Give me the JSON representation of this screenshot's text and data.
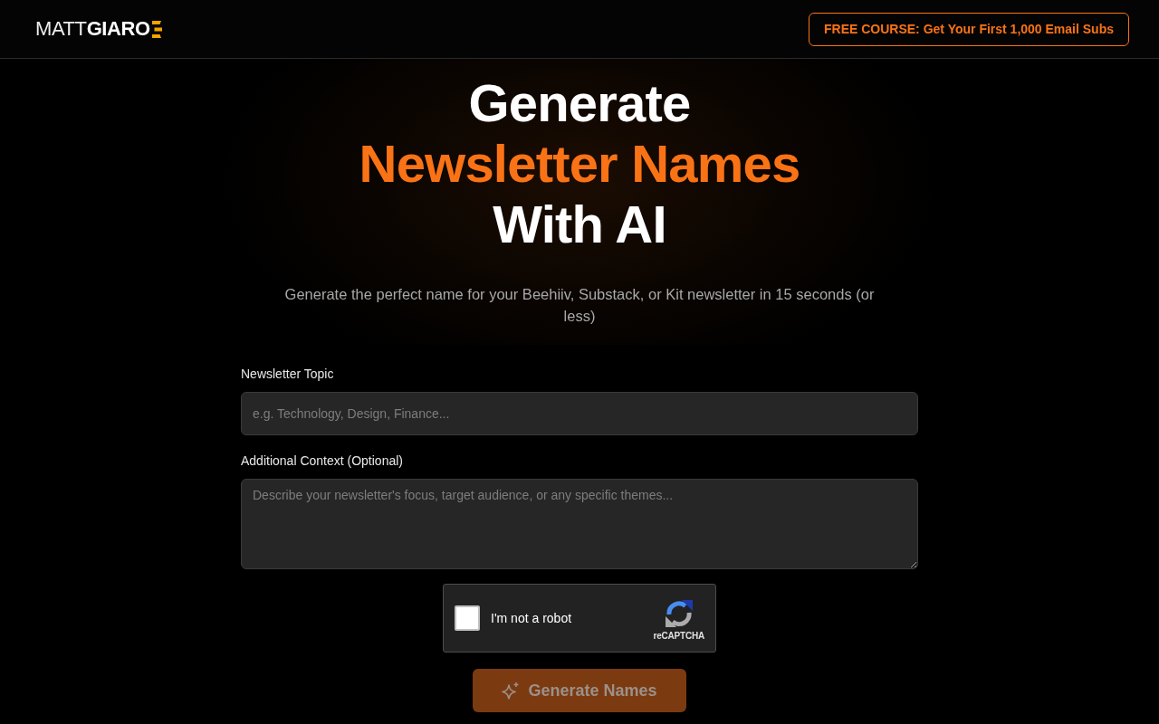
{
  "header": {
    "logo": "MATT**GIARO**",
    "cta_button": "FREE COURSE: Get Your First 1,000 Email Subs"
  },
  "hero": {
    "title_lines": [
      {
        "text": "Generate",
        "highlight": false
      },
      {
        "text": "Newsletter Names",
        "highlight": true
      },
      {
        "text": "With AI",
        "highlight": false
      }
    ],
    "subtitle": "Generate the perfect name for your Beehiiv, Substack, or Kit newsletter in 15 seconds (or less)"
  },
  "form": {
    "fields": [
      {
        "kind": "input",
        "label": "Newsletter Topic",
        "placeholder": "e.g. Technology, Design, Finance..."
      },
      {
        "kind": "textarea",
        "label": "Additional Context (Optional)",
        "placeholder": "Describe your newsletter's focus, target audience, or any specific themes..."
      }
    ],
    "captcha": {
      "label": "I'm not a robot",
      "checked": false,
      "brand": "reCAPTCHA"
    },
    "submit": {
      "label": "Generate Names",
      "disabled": true
    }
  }
}
